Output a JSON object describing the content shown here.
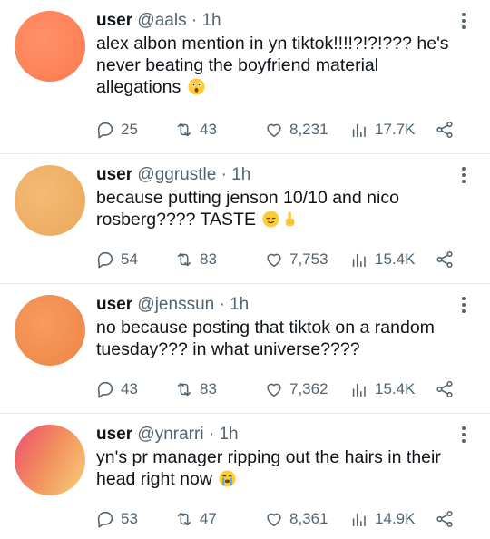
{
  "tweets": [
    {
      "user": "user",
      "handle": "@aals",
      "separator": "·",
      "time": "1h",
      "text": "alex albon mention in yn tiktok!!!!?!?!??? he's never beating the boyfriend material allegations",
      "emoji": [
        "astonished-face"
      ],
      "avatar_colors": [
        "#ff8a5c",
        "#fd7b4e"
      ],
      "replies": "25",
      "retweets": "43",
      "likes": "8,231",
      "views": "17.7K"
    },
    {
      "user": "user",
      "handle": "@ggrustle",
      "separator": "·",
      "time": "1h",
      "text": "because putting jenson 10/10 and nico rosberg???? TASTE",
      "emoji": [
        "relieved-face",
        "pointing-up-hand"
      ],
      "avatar_colors": [
        "#f2b46c",
        "#e9a95b"
      ],
      "replies": "54",
      "retweets": "83",
      "likes": "7,753",
      "views": "15.4K"
    },
    {
      "user": "user",
      "handle": "@jenssun",
      "separator": "·",
      "time": "1h",
      "text": "no because posting that tiktok on a random tuesday??? in what universe????",
      "emoji": [],
      "avatar_colors": [
        "#f7975a",
        "#ed8646"
      ],
      "replies": "43",
      "retweets": "83",
      "likes": "7,362",
      "views": "15.4K"
    },
    {
      "user": "user",
      "handle": "@ynrarri",
      "separator": "·",
      "time": "1h",
      "text": "yn's pr manager ripping out the hairs in their head right now",
      "emoji": [
        "loudly-crying-face"
      ],
      "avatar_colors": [
        "#ee4f6e",
        "#f7cb73"
      ],
      "replies": "53",
      "retweets": "47",
      "likes": "8,361",
      "views": "14.9K"
    }
  ]
}
